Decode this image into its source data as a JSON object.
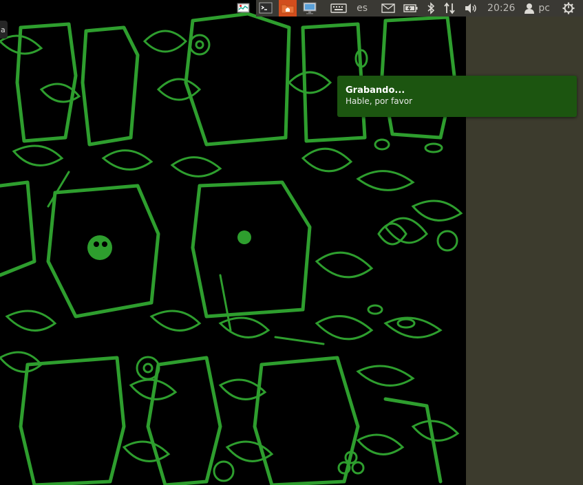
{
  "topbar": {
    "keyboard_layout": "es",
    "time": "20:26",
    "user": "pc"
  },
  "left_tab": {
    "label": "a"
  },
  "notification": {
    "title": "Grabando...",
    "body": "Hable, por favor"
  },
  "wallpaper": {
    "line_color": "#2e9e2e",
    "background": "#000000"
  },
  "colors": {
    "panel_bg": "#3a3934",
    "side_bg": "#3c3b2d",
    "notification_bg": "#1c5510"
  },
  "icons": [
    "system-monitor-icon",
    "terminal-icon",
    "home-folder-icon",
    "display-monitor-icon",
    "keyboard-icon",
    "mail-icon",
    "battery-icon",
    "bluetooth-icon",
    "network-transfer-icon",
    "volume-icon",
    "user-icon",
    "power-gear-icon"
  ]
}
